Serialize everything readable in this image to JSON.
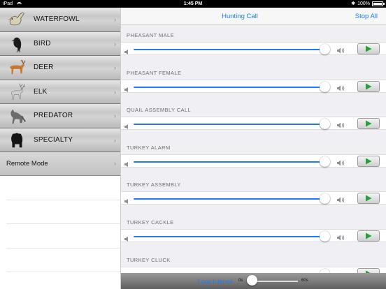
{
  "status": {
    "device": "iPad",
    "time": "1:45 PM",
    "battery": "100%"
  },
  "sidebar": {
    "categories": [
      {
        "label": "WATERFOWL",
        "icon": "duck-icon"
      },
      {
        "label": "BIRD",
        "icon": "crow-icon"
      },
      {
        "label": "DEER",
        "icon": "deer-icon"
      },
      {
        "label": "ELK",
        "icon": "elk-icon"
      },
      {
        "label": "PREDATOR",
        "icon": "wolf-icon"
      },
      {
        "label": "SPECIALTY",
        "icon": "bear-icon"
      }
    ],
    "remote_label": "Remote Mode"
  },
  "navbar": {
    "title": "Hunting Call",
    "stop_all": "Stop All"
  },
  "calls": [
    {
      "name": "PHEASANT MALE",
      "volume": 1.0
    },
    {
      "name": "PHEASANT FEMALE",
      "volume": 1.0
    },
    {
      "name": "QUAIL ASSEMBLY CALL",
      "volume": 1.0
    },
    {
      "name": "TURKEY ALARM",
      "volume": 1.0
    },
    {
      "name": "TURKEY ASSEMBLY",
      "volume": 1.0
    },
    {
      "name": "TURKEY CACKLE",
      "volume": 1.0
    },
    {
      "name": "TURKEY CLUCK",
      "volume": 1.0
    }
  ],
  "loop": {
    "label": "Loop Interval",
    "min": "0s",
    "max": "60s",
    "value": 0
  },
  "colors": {
    "accent": "#1e7cf2",
    "play_green": "#1fa43a"
  }
}
